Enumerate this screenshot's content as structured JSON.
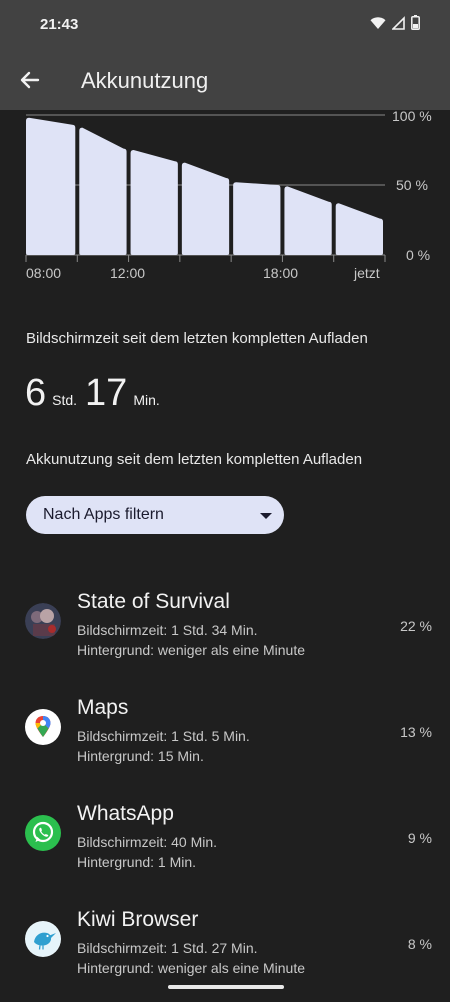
{
  "status": {
    "time": "21:43"
  },
  "appbar": {
    "title": "Akkunutzung"
  },
  "chart_data": {
    "type": "bar",
    "categories": [
      "08:00",
      "",
      "12:00",
      "",
      "",
      "18:00",
      "",
      "jetzt"
    ],
    "x_tick_labels": [
      "08:00",
      "12:00",
      "18:00",
      "jetzt"
    ],
    "y_tick_labels": [
      "100 %",
      "50 %",
      "0 %"
    ],
    "ylim": [
      0,
      100
    ],
    "bars": [
      {
        "start": 98,
        "end": 93
      },
      {
        "start": 91,
        "end": 76
      },
      {
        "start": 75,
        "end": 67
      },
      {
        "start": 66,
        "end": 55
      },
      {
        "start": 52,
        "end": 50
      },
      {
        "start": 49,
        "end": 38
      },
      {
        "start": 37,
        "end": 26
      }
    ],
    "bar_color": "#dfe3f6",
    "grid": true
  },
  "screentime": {
    "title": "Bildschirmzeit seit dem letzten kompletten Aufladen",
    "hours": "6",
    "hours_unit": "Std.",
    "minutes": "17",
    "minutes_unit": "Min."
  },
  "usage": {
    "title": "Akkunutzung seit dem letzten kompletten Aufladen",
    "filter_label": "Nach Apps filtern"
  },
  "apps": [
    {
      "name": "State of Survival",
      "line1": "Bildschirmzeit: 1 Std. 34 Min.",
      "line2": "Hintergrund: weniger als eine Minute",
      "pct": "22 %",
      "icon": "state-of-survival-icon"
    },
    {
      "name": "Maps",
      "line1": "Bildschirmzeit: 1 Std. 5 Min.",
      "line2": "Hintergrund: 15 Min.",
      "pct": "13 %",
      "icon": "maps-icon"
    },
    {
      "name": "WhatsApp",
      "line1": "Bildschirmzeit: 40 Min.",
      "line2": "Hintergrund: 1 Min.",
      "pct": "9 %",
      "icon": "whatsapp-icon"
    },
    {
      "name": "Kiwi Browser",
      "line1": "Bildschirmzeit: 1 Std. 27 Min.",
      "line2": "Hintergrund: weniger als eine Minute",
      "pct": "8 %",
      "icon": "kiwi-browser-icon"
    }
  ]
}
